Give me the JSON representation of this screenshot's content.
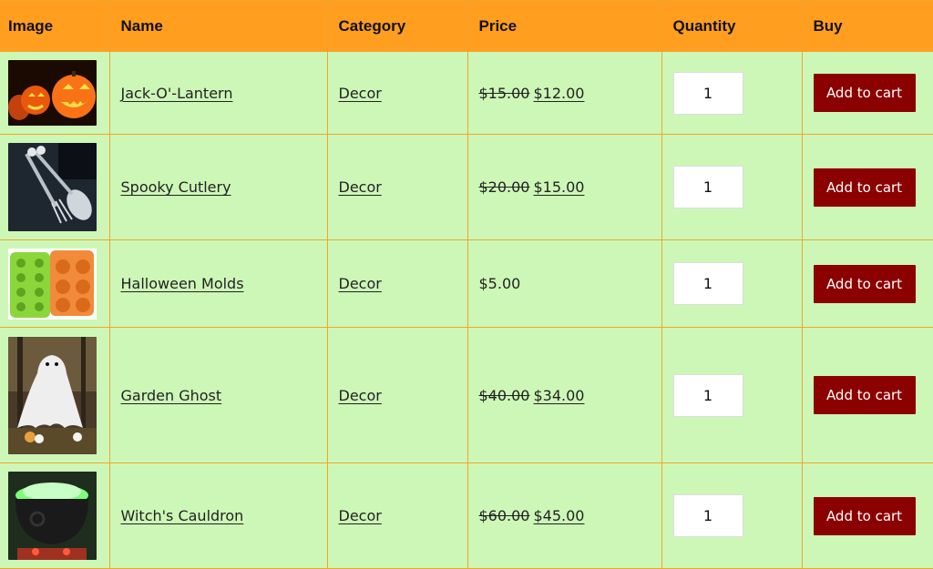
{
  "headers": {
    "image": "Image",
    "name": "Name",
    "category": "Category",
    "price": "Price",
    "quantity": "Quantity",
    "buy": "Buy"
  },
  "products": [
    {
      "name": "Jack-O'-Lantern",
      "category": "Decor",
      "old_price": "$15.00",
      "price": "$12.00",
      "quantity": "1",
      "button": "Add to cart",
      "image": "pumpkins"
    },
    {
      "name": "Spooky Cutlery",
      "category": "Decor",
      "old_price": "$20.00",
      "price": "$15.00",
      "quantity": "1",
      "button": "Add to cart",
      "image": "skeleton-cutlery"
    },
    {
      "name": "Halloween Molds",
      "category": "Decor",
      "old_price": "",
      "price": "$5.00",
      "quantity": "1",
      "button": "Add to cart",
      "image": "silicone-molds"
    },
    {
      "name": "Garden Ghost",
      "category": "Decor",
      "old_price": "$40.00",
      "price": "$34.00",
      "quantity": "1",
      "button": "Add to cart",
      "image": "garden-ghost"
    },
    {
      "name": "Witch's Cauldron",
      "category": "Decor",
      "old_price": "$60.00",
      "price": "$45.00",
      "quantity": "1",
      "button": "Add to cart",
      "image": "cauldron"
    }
  ],
  "colors": {
    "header_bg": "#ff9e1f",
    "row_bg": "#cdf7b7",
    "border": "#f0a52c",
    "button_bg": "#8b0000"
  }
}
